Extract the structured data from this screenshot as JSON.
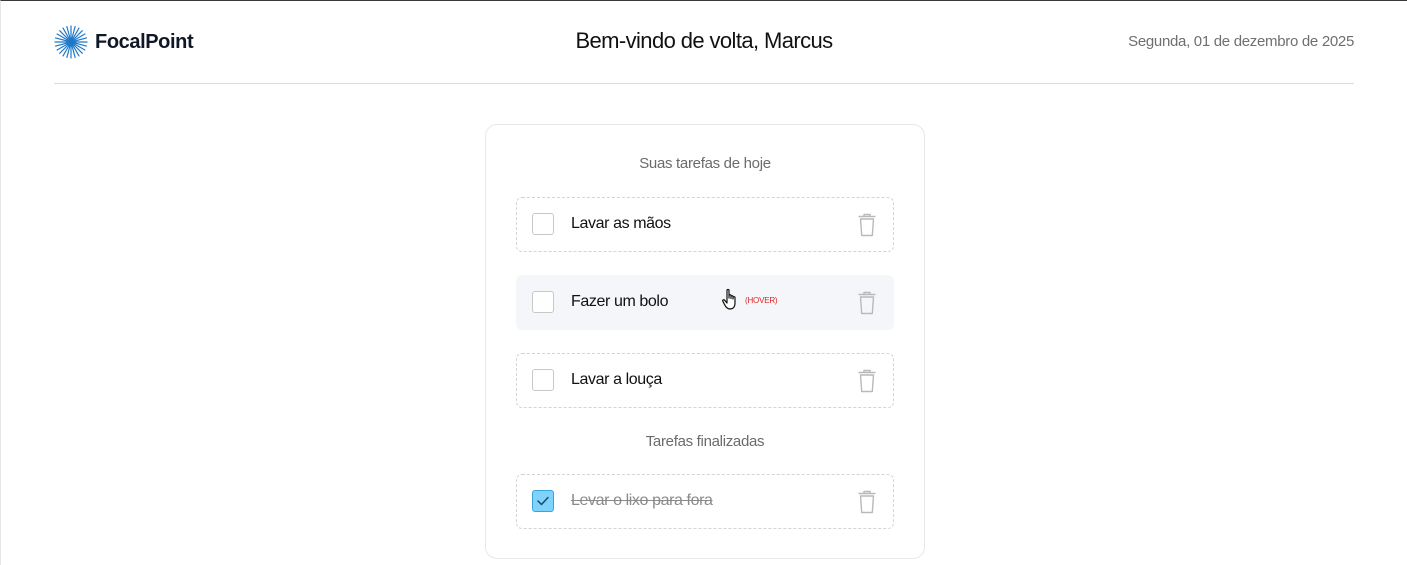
{
  "app": {
    "name": "FocalPoint",
    "logo_icon": "starburst-icon",
    "accent_color": "#1f78c8"
  },
  "header": {
    "welcome": "Bem-vindo de volta, Marcus",
    "date": "Segunda, 01 de dezembro de 2025"
  },
  "tasks_card": {
    "today_title": "Suas tarefas de hoje",
    "finished_title": "Tarefas finalizadas",
    "today": [
      {
        "label": "Lavar as mãos",
        "checked": false
      },
      {
        "label": "Fazer um bolo",
        "checked": false,
        "state": "hover"
      },
      {
        "label": "Lavar a louça",
        "checked": false
      }
    ],
    "finished": [
      {
        "label": "Levar o lixo para fora",
        "checked": true
      }
    ],
    "check_color": "#7dd3fc",
    "delete_icon": "trash-icon"
  },
  "annotation": {
    "hover_label": "(HOVER)",
    "cursor_icon": "hand-pointer-icon",
    "color": "#e02424"
  }
}
